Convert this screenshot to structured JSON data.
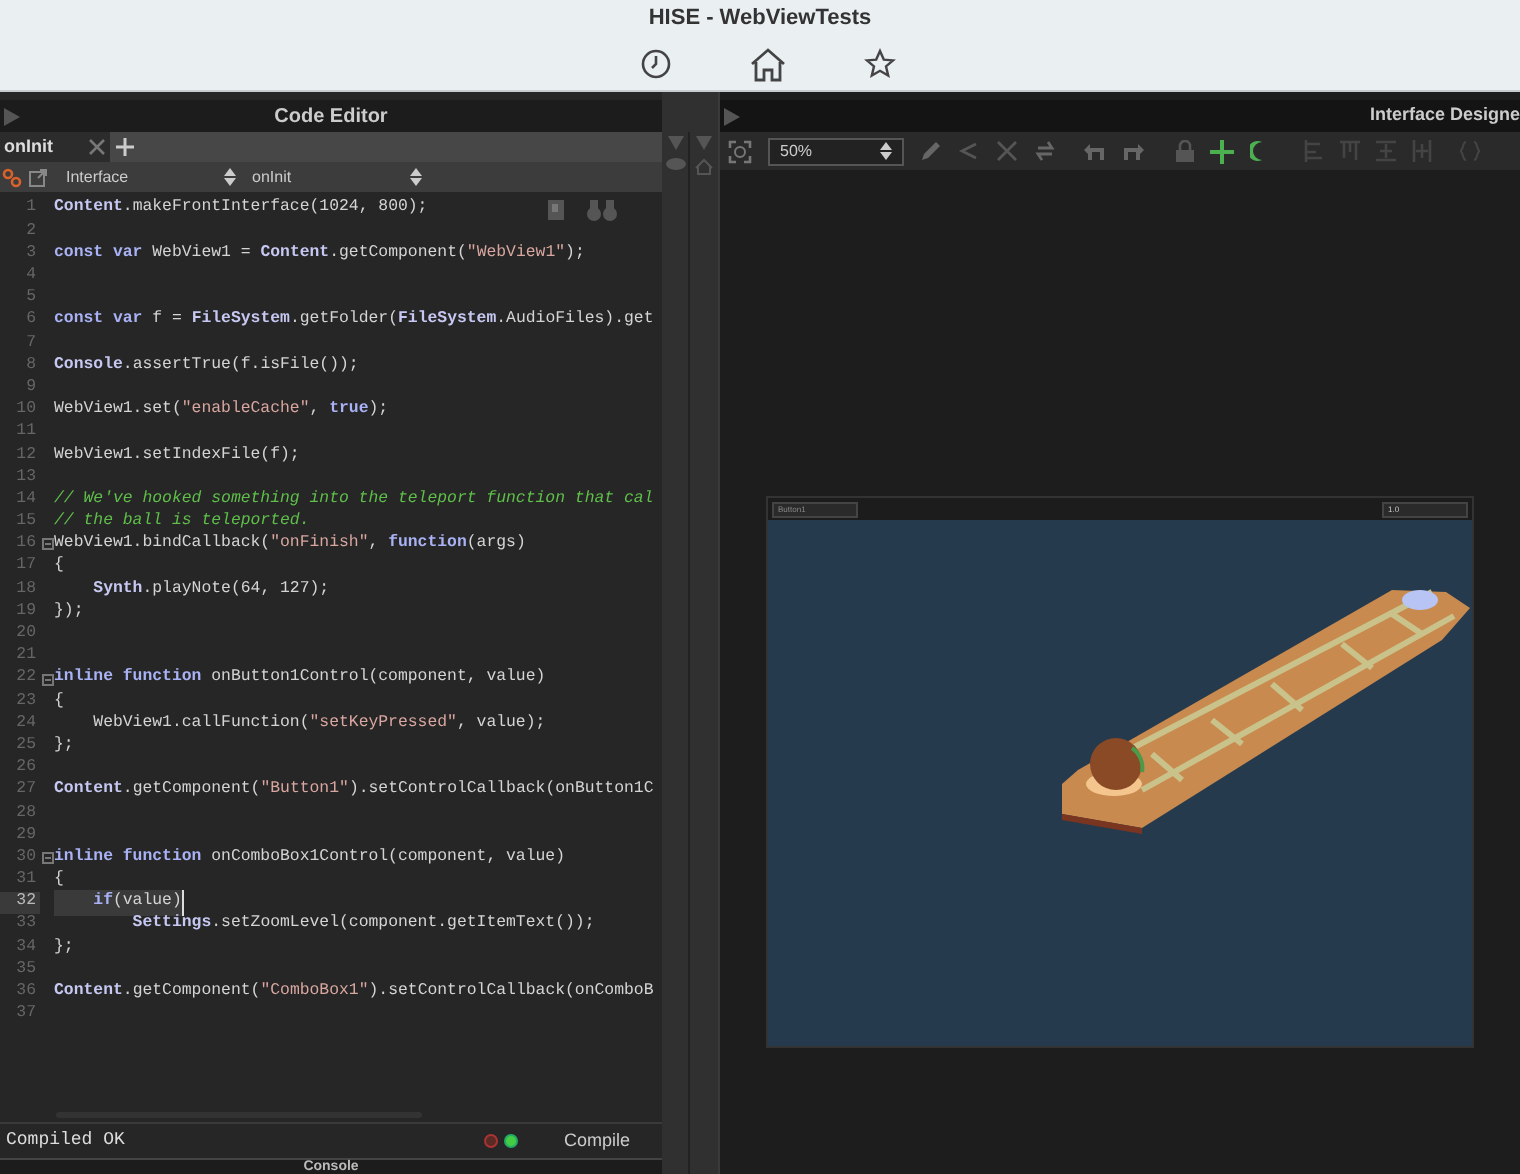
{
  "window": {
    "title": "HISE - WebViewTests"
  },
  "code_editor": {
    "title": "Code Editor",
    "tabs": [
      {
        "label": "onInit",
        "selected": true
      }
    ],
    "selectors": [
      {
        "value": "Interface"
      },
      {
        "value": "onInit"
      }
    ],
    "lines": [
      {
        "number": "1",
        "tokens": [
          {
            "kind": "obj",
            "text": "Content"
          },
          {
            "kind": "plain",
            "text": ".makeFrontInterface(1024, 800);"
          }
        ]
      },
      {
        "number": "2"
      },
      {
        "number": "3",
        "tokens": [
          {
            "kind": "kw",
            "text": "const var"
          },
          {
            "kind": "plain",
            "text": " WebView1 = "
          },
          {
            "kind": "obj",
            "text": "Content"
          },
          {
            "kind": "plain",
            "text": ".getComponent("
          },
          {
            "kind": "str",
            "text": "\"WebView1\""
          },
          {
            "kind": "plain",
            "text": ");"
          }
        ]
      },
      {
        "number": "4"
      },
      {
        "number": "5"
      },
      {
        "number": "6",
        "tokens": [
          {
            "kind": "kw",
            "text": "const var"
          },
          {
            "kind": "plain",
            "text": " f = "
          },
          {
            "kind": "obj",
            "text": "FileSystem"
          },
          {
            "kind": "plain",
            "text": ".getFolder("
          },
          {
            "kind": "obj",
            "text": "FileSystem"
          },
          {
            "kind": "plain",
            "text": ".AudioFiles).get"
          }
        ]
      },
      {
        "number": "7"
      },
      {
        "number": "8",
        "tokens": [
          {
            "kind": "obj",
            "text": "Console"
          },
          {
            "kind": "plain",
            "text": ".assertTrue(f.isFile());"
          }
        ]
      },
      {
        "number": "9"
      },
      {
        "number": "10",
        "tokens": [
          {
            "kind": "plain",
            "text": "WebView1.set("
          },
          {
            "kind": "str",
            "text": "\"enableCache\""
          },
          {
            "kind": "plain",
            "text": ", "
          },
          {
            "kind": "kw",
            "text": "true"
          },
          {
            "kind": "plain",
            "text": ");"
          }
        ]
      },
      {
        "number": "11"
      },
      {
        "number": "12",
        "tokens": [
          {
            "kind": "plain",
            "text": "WebView1.setIndexFile(f);"
          }
        ]
      },
      {
        "number": "13"
      },
      {
        "number": "14",
        "tokens": [
          {
            "kind": "comment",
            "text": "// We've hooked something into the teleport function that cal"
          }
        ]
      },
      {
        "number": "15",
        "tokens": [
          {
            "kind": "comment",
            "text": "// the ball is teleported."
          }
        ]
      },
      {
        "number": "16",
        "fold": true,
        "tokens": [
          {
            "kind": "plain",
            "text": "WebView1.bindCallback("
          },
          {
            "kind": "str",
            "text": "\"onFinish\""
          },
          {
            "kind": "plain",
            "text": ", "
          },
          {
            "kind": "kw",
            "text": "function"
          },
          {
            "kind": "plain",
            "text": "(args)"
          }
        ]
      },
      {
        "number": "17",
        "tokens": [
          {
            "kind": "plain",
            "text": "{"
          }
        ]
      },
      {
        "number": "18",
        "tokens": [
          {
            "kind": "obj",
            "text": "    Synth"
          },
          {
            "kind": "plain",
            "text": ".playNote(64, 127);"
          }
        ]
      },
      {
        "number": "19",
        "tokens": [
          {
            "kind": "plain",
            "text": "});"
          }
        ]
      },
      {
        "number": "20"
      },
      {
        "number": "21"
      },
      {
        "number": "22",
        "fold": true,
        "tokens": [
          {
            "kind": "kw",
            "text": "inline function"
          },
          {
            "kind": "plain",
            "text": " onButton1Control(component, value)"
          }
        ]
      },
      {
        "number": "23",
        "tokens": [
          {
            "kind": "plain",
            "text": "{"
          }
        ]
      },
      {
        "number": "24",
        "tokens": [
          {
            "kind": "plain",
            "text": "    WebView1.callFunction("
          },
          {
            "kind": "str",
            "text": "\"setKeyPressed\""
          },
          {
            "kind": "plain",
            "text": ", value);"
          }
        ]
      },
      {
        "number": "25",
        "tokens": [
          {
            "kind": "plain",
            "text": "};"
          }
        ]
      },
      {
        "number": "26"
      },
      {
        "number": "27",
        "tokens": [
          {
            "kind": "obj",
            "text": "Content"
          },
          {
            "kind": "plain",
            "text": ".getComponent("
          },
          {
            "kind": "str",
            "text": "\"Button1\""
          },
          {
            "kind": "plain",
            "text": ").setControlCallback(onButton1C"
          }
        ]
      },
      {
        "number": "28"
      },
      {
        "number": "29"
      },
      {
        "number": "30",
        "fold": true,
        "tokens": [
          {
            "kind": "kw",
            "text": "inline function"
          },
          {
            "kind": "plain",
            "text": " onComboBox1Control(component, value)"
          }
        ]
      },
      {
        "number": "31",
        "tokens": [
          {
            "kind": "plain",
            "text": "{"
          }
        ]
      },
      {
        "number": "32",
        "current": true,
        "tokens": [
          {
            "kind": "kw",
            "text": "    if"
          },
          {
            "kind": "plain",
            "text": "(value)"
          }
        ]
      },
      {
        "number": "33",
        "tokens": [
          {
            "kind": "obj",
            "text": "        Settings"
          },
          {
            "kind": "plain",
            "text": ".setZoomLevel(component.getItemText());"
          }
        ]
      },
      {
        "number": "34",
        "tokens": [
          {
            "kind": "plain",
            "text": "};"
          }
        ]
      },
      {
        "number": "35"
      },
      {
        "number": "36",
        "tokens": [
          {
            "kind": "obj",
            "text": "Content"
          },
          {
            "kind": "plain",
            "text": ".getComponent("
          },
          {
            "kind": "str",
            "text": "\"ComboBox1\""
          },
          {
            "kind": "plain",
            "text": ").setControlCallback(onComboB"
          }
        ]
      },
      {
        "number": "37"
      }
    ],
    "status": "Compiled OK",
    "compile_button": "Compile"
  },
  "interface_designer": {
    "title": "Interface Designe",
    "zoom": "50%",
    "preview": {
      "button": "Button1",
      "combo": "1.0"
    }
  },
  "console": {
    "title": "Console"
  }
}
